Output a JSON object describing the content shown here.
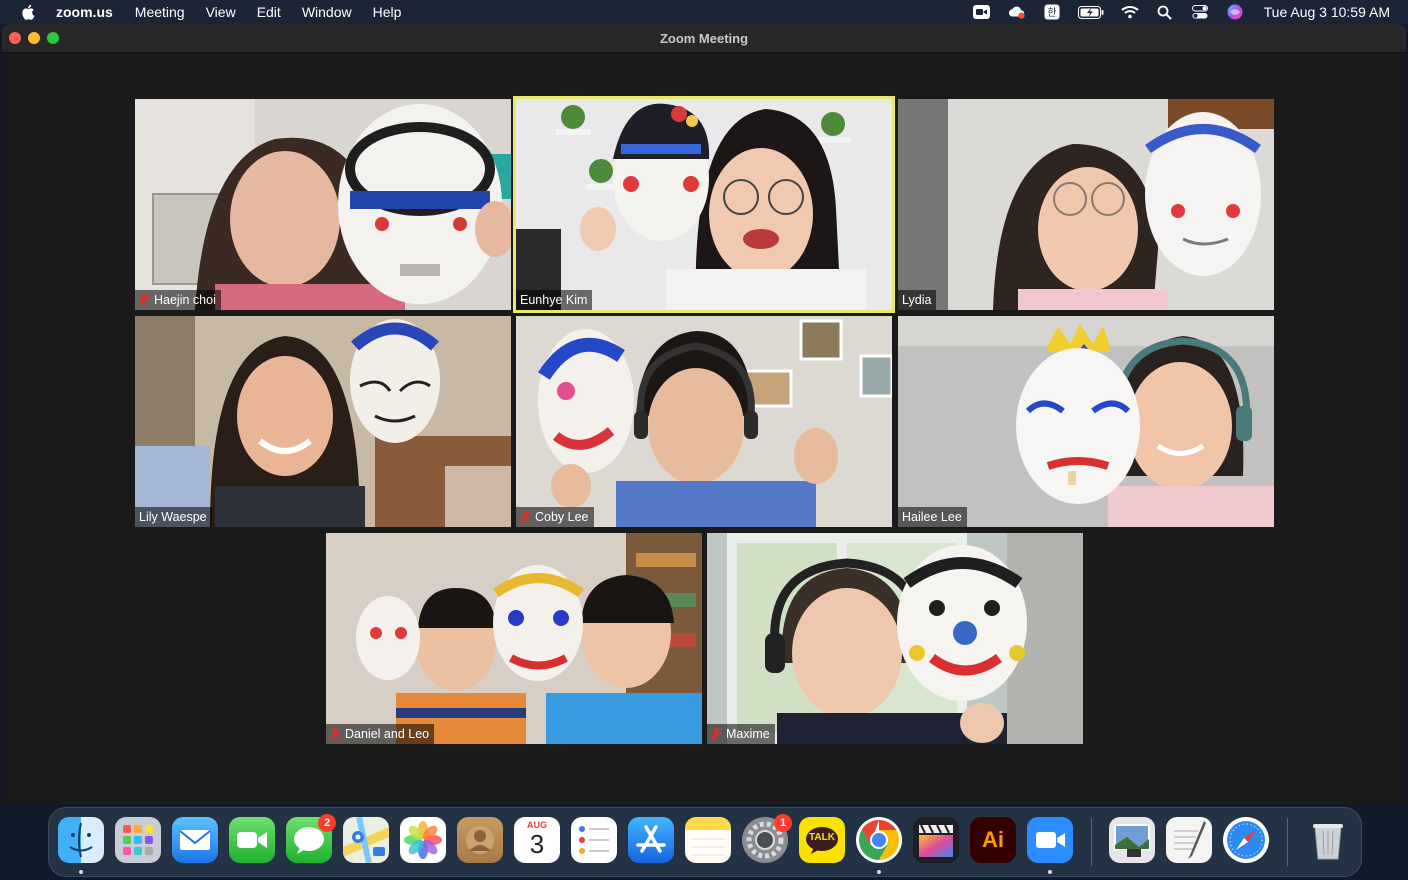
{
  "menubar": {
    "app_name": "zoom.us",
    "menus": [
      "Meeting",
      "View",
      "Edit",
      "Window",
      "Help"
    ],
    "clock": "Tue Aug 3  10:59 AM",
    "status_icons": [
      "zoom-icon",
      "creative-cloud-icon",
      "input-method-icon",
      "battery-icon",
      "wifi-icon",
      "spotlight-search-icon",
      "control-center-icon",
      "siri-icon"
    ]
  },
  "window": {
    "title": "Zoom Meeting"
  },
  "participants": [
    {
      "name": "Haejin choi",
      "muted": true,
      "active": false
    },
    {
      "name": "Eunhye Kim",
      "muted": false,
      "active": true
    },
    {
      "name": "Lydia",
      "muted": false,
      "active": false
    },
    {
      "name": "Lily Waespe",
      "muted": false,
      "active": false
    },
    {
      "name": "Coby Lee",
      "muted": true,
      "active": false
    },
    {
      "name": "Hailee Lee",
      "muted": false,
      "active": false
    },
    {
      "name": "Daniel and Leo",
      "muted": true,
      "active": false
    },
    {
      "name": "Maxime",
      "muted": true,
      "active": false
    }
  ],
  "dock": {
    "apps": [
      {
        "name": "finder-icon",
        "running": true
      },
      {
        "name": "launchpad-icon",
        "running": false
      },
      {
        "name": "mail-icon",
        "running": false
      },
      {
        "name": "facetime-icon",
        "running": false
      },
      {
        "name": "messages-icon",
        "badge": "2",
        "running": false
      },
      {
        "name": "maps-icon",
        "running": false
      },
      {
        "name": "photos-icon",
        "running": false
      },
      {
        "name": "contacts-icon",
        "running": false
      },
      {
        "name": "calendar-icon",
        "calendar_month": "AUG",
        "calendar_day": "3",
        "running": false
      },
      {
        "name": "reminders-icon",
        "running": false
      },
      {
        "name": "app-store-icon",
        "running": false
      },
      {
        "name": "notes-icon",
        "running": false
      },
      {
        "name": "system-preferences-icon",
        "badge": "1",
        "running": false
      },
      {
        "name": "kakaotalk-icon",
        "label": "TALK",
        "running": false
      },
      {
        "name": "chrome-icon",
        "running": true
      },
      {
        "name": "final-cut-pro-icon",
        "running": false
      },
      {
        "name": "illustrator-icon",
        "label": "Ai",
        "running": false
      },
      {
        "name": "zoom-app-icon",
        "running": true
      },
      {
        "name": "preview-icon",
        "running": false
      },
      {
        "name": "textedit-icon",
        "running": false
      },
      {
        "name": "safari-icon",
        "running": false
      },
      {
        "name": "trash-icon",
        "running": false
      }
    ]
  }
}
